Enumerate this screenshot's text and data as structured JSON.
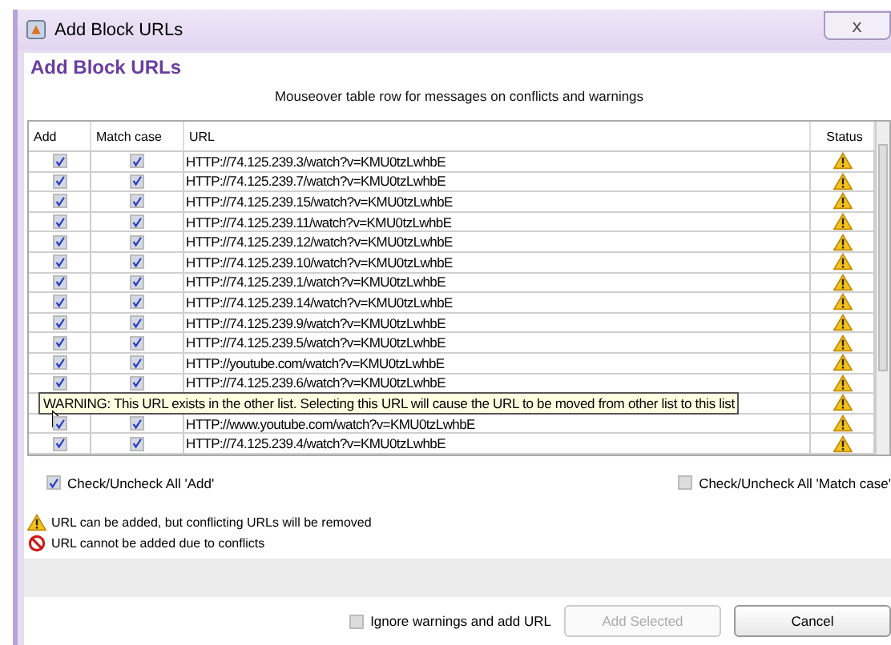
{
  "window": {
    "title": "Add Block URLs",
    "close": "ⅹ"
  },
  "panel": {
    "title": "Add Block URLs",
    "hint": "Mouseover table row  for messages on conflicts and warnings"
  },
  "table": {
    "columns": [
      "Add",
      "Match case",
      "URL",
      "Status"
    ],
    "rows": [
      {
        "add": true,
        "match_case": true,
        "url": "HTTP://74.125.239.3/watch?v=KMU0tzLwhbE",
        "kind": "warning"
      },
      {
        "add": true,
        "match_case": true,
        "url": "HTTP://74.125.239.7/watch?v=KMU0tzLwhbE",
        "kind": "warning"
      },
      {
        "add": true,
        "match_case": true,
        "url": "HTTP://74.125.239.15/watch?v=KMU0tzLwhbE",
        "kind": "warning"
      },
      {
        "add": true,
        "match_case": true,
        "url": "HTTP://74.125.239.11/watch?v=KMU0tzLwhbE",
        "kind": "warning"
      },
      {
        "add": true,
        "match_case": true,
        "url": "HTTP://74.125.239.12/watch?v=KMU0tzLwhbE",
        "kind": "warning"
      },
      {
        "add": true,
        "match_case": true,
        "url": "HTTP://74.125.239.10/watch?v=KMU0tzLwhbE",
        "kind": "warning"
      },
      {
        "add": true,
        "match_case": true,
        "url": "HTTP://74.125.239.1/watch?v=KMU0tzLwhbE",
        "kind": "warning"
      },
      {
        "add": true,
        "match_case": true,
        "url": "HTTP://74.125.239.14/watch?v=KMU0tzLwhbE",
        "kind": "warning"
      },
      {
        "add": true,
        "match_case": true,
        "url": "HTTP://74.125.239.9/watch?v=KMU0tzLwhbE",
        "kind": "warning"
      },
      {
        "add": true,
        "match_case": true,
        "url": "HTTP://74.125.239.5/watch?v=KMU0tzLwhbE",
        "kind": "warning"
      },
      {
        "add": true,
        "match_case": true,
        "url": "HTTP://youtube.com/watch?v=KMU0tzLwhbE",
        "kind": "warning"
      },
      {
        "add": true,
        "match_case": true,
        "url": "HTTP://74.125.239.6/watch?v=KMU0tzLwhbE",
        "kind": "warning"
      },
      {
        "kind": "warning"
      },
      {
        "add": true,
        "match_case": true,
        "url": "HTTP://www.youtube.com/watch?v=KMU0tzLwhbE",
        "kind": "warning"
      },
      {
        "add": true,
        "match_case": true,
        "url": "HTTP://74.125.239.4/watch?v=KMU0tzLwhbE",
        "kind": "warning"
      }
    ],
    "tooltip": "WARNING: This URL exists in the other list. Selecting this URL will cause the URL to be moved from other list to this list"
  },
  "check_all_add": {
    "label": "Check/Uncheck All 'Add'",
    "checked": true
  },
  "check_all_match": {
    "label": "Check/Uncheck All 'Match case'",
    "checked": false
  },
  "legend": [
    {
      "kind": "warning",
      "text": "URL can be added, but conflicting URLs will be removed"
    },
    {
      "kind": "error",
      "text": "URL cannot be added due to conflicts"
    }
  ],
  "ignore": {
    "label": "Ignore warnings and add URL",
    "checked": false
  },
  "buttons": [
    {
      "label": "Add Selected",
      "disabled": true
    },
    {
      "label": "Cancel",
      "disabled": false
    }
  ]
}
